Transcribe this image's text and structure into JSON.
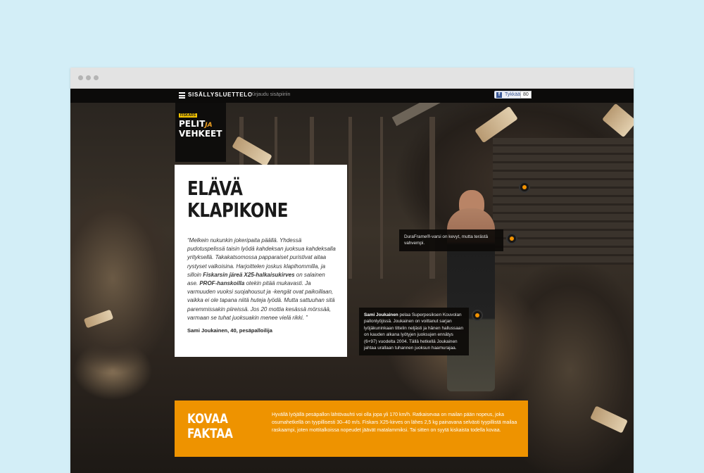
{
  "nav": {
    "menu_label": "SISÄLLYSLUETTELO",
    "login_link": "Kirjaudu sisäpiiriin",
    "like_label": "Tykkää",
    "like_count": "80"
  },
  "logo": {
    "brand": "FISKARS",
    "line1": "PELIT",
    "ja": "JA",
    "line2": "VEHKEET"
  },
  "article": {
    "title_line1": "ELÄVÄ",
    "title_line2": "KLAPIKONE",
    "quote_open": "“",
    "quote_part1": "Melkein nukunkin jokeripaita päällä. Yhdessä pudotuspelissä taisin lyödä kahdeksan juoksua kahdeksalla yrityksellä. Takakatsomossa papparaiset puristivat aitaa rystyset valkoisina. Harjoittelen joskus klapihommilla, ja silloin ",
    "quote_bold1": "Fiskarsin järeä X25-halkaisukirves",
    "quote_part2": " on salainen ase. ",
    "quote_bold2": "PROF-hanskoilla",
    "quote_part3": " otekin pitää mukavasti. Ja varmuuden vuoksi suojahousut ja -kengät ovat paikoillaan, vaikka ei ole tapana niitä huteja lyödä. Mutta sattuuhan sitä paremmissakin piireissä. Jos 20 mottia kesässä mörssää, varmaan se tuhat juoksuakin menee vielä rikki. ”",
    "author": "Sami Joukainen, 40, pesäpalloilija"
  },
  "tooltips": {
    "duraframe": "DuraFrame®-varsi on kevyt, mutta terästä vahvempi.",
    "bio_name": "Sami Joukainen",
    "bio_text": " pelaa Superpesiksen Kouvolan pallonlyöjissä. Joukainen on voittanut sarjan lyöjäkuninkaan tittelin neljästi ja hänen hallussaan on kauden alkana lyötyjen juoksujen ennätys (6+97) vuodelta 2004. Tällä hetkellä Joukainen jahtaa urallaan tuhannen juoksun haamurajaa."
  },
  "facts": {
    "title_line1": "KOVAA",
    "title_line2": "FAKTAA",
    "text": "Hyvällä lyöjällä pesäpallon lähtövauhti voi olla jopa yli 170 km/h. Ratkaisevaa on mailan pään nopeus, joka osumahetkellä on tyypillisesti 30–40 m/s. Fiskars X25-kirves on lähes 2,5 kg painavana selvästi tyypillistä mailaa raskaampi, joten mottitalkoissa nopeudet jäävät matalammiksi. Tai sitten on syytä kiskaista todella kovaa."
  },
  "colors": {
    "accent": "#ee9300",
    "page_bg": "#d3eef7",
    "topbar": "#0c0b0a"
  }
}
